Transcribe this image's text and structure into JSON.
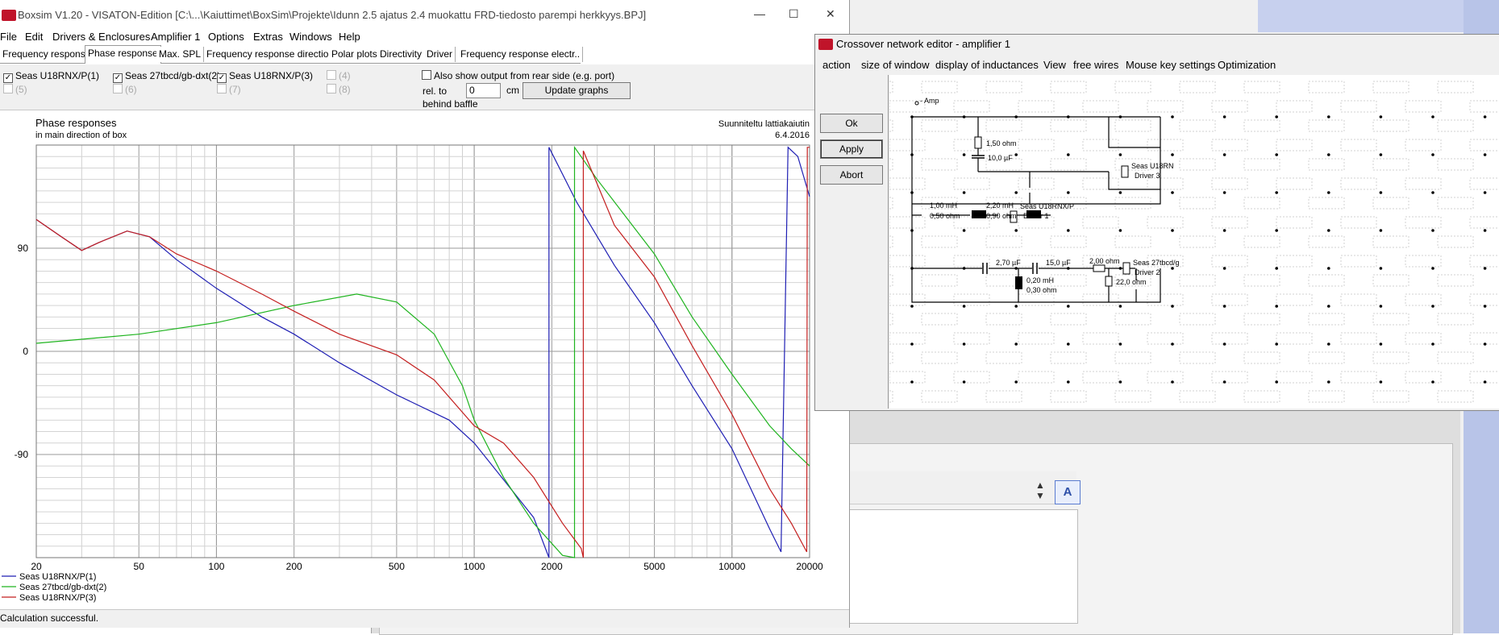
{
  "main_window": {
    "title": "Boxsim V1.20 - VISATON-Edition [C:\\...\\Kaiuttimet\\BoxSim\\Projekte\\Idunn 2.5 ajatus 2.4 muokattu FRD-tiedosto parempi herkkyys.BPJ]",
    "controls": {
      "minimize": "—",
      "maximize": "☐",
      "close": "✕"
    },
    "menu": [
      "File",
      "Edit",
      "Drivers & Enclosures",
      "Amplifier 1",
      "Options",
      "Extras",
      "Windows",
      "Help"
    ],
    "tabs": [
      "Frequency response.",
      "Phase response",
      "Max. SPL",
      "Frequency response directions",
      "Polar plots",
      "Directivity",
      "Driver",
      "Frequency response electr.."
    ],
    "active_tab": "Phase response",
    "drivers": [
      {
        "label": "Seas U18RNX/P(1)",
        "checked": true
      },
      {
        "label": "Seas 27tbcd/gb-dxt(2)",
        "checked": true
      },
      {
        "label": "Seas U18RNX/P(3)",
        "checked": true
      },
      {
        "label": "(4)",
        "checked": false
      },
      {
        "label": "(5)",
        "checked": false
      },
      {
        "label": "(6)",
        "checked": false
      },
      {
        "label": "(7)",
        "checked": false
      },
      {
        "label": "(8)",
        "checked": false
      }
    ],
    "rear_side_label": "Also show output from rear side (e.g. port)",
    "rel_to_label": "rel. to",
    "behind_baffle_label": "behind baffle",
    "rel_value": "0",
    "rel_unit": "cm",
    "update_button": "Update graphs",
    "status": "Calculation successful."
  },
  "chart_data": {
    "type": "line",
    "title": "Phase responses",
    "subtitle": "in main direction of box",
    "annotation_right_1": "Suunniteltu lattiakaiutin",
    "annotation_right_2": "6.4.2016",
    "x_scale": "log",
    "xlim": [
      20,
      20000
    ],
    "ylim": [
      -180,
      180
    ],
    "x_ticks": [
      20,
      50,
      100,
      200,
      500,
      1000,
      2000,
      5000,
      10000,
      20000
    ],
    "y_ticks": [
      90,
      0,
      -90
    ],
    "grid": true,
    "legend_position": "bottom-left",
    "series": [
      {
        "name": "Seas U18RNX/P(1)",
        "color": "#1f1fb4",
        "points": [
          [
            20,
            115
          ],
          [
            25,
            100
          ],
          [
            30,
            88
          ],
          [
            35,
            95
          ],
          [
            45,
            105
          ],
          [
            55,
            100
          ],
          [
            70,
            80
          ],
          [
            100,
            55
          ],
          [
            150,
            30
          ],
          [
            200,
            15
          ],
          [
            300,
            -10
          ],
          [
            500,
            -38
          ],
          [
            800,
            -60
          ],
          [
            1000,
            -80
          ],
          [
            1300,
            -112
          ],
          [
            1700,
            -145
          ],
          [
            1950,
            -180
          ],
          [
            1950,
            178
          ],
          [
            2500,
            130
          ],
          [
            3500,
            75
          ],
          [
            5000,
            25
          ],
          [
            7000,
            -30
          ],
          [
            10000,
            -85
          ],
          [
            14000,
            -155
          ],
          [
            15500,
            -175
          ],
          [
            16500,
            178
          ],
          [
            18000,
            170
          ],
          [
            20000,
            135
          ]
        ]
      },
      {
        "name": "Seas 27tbcd/gb-dxt(2)",
        "color": "#1fb41f",
        "points": [
          [
            20,
            7
          ],
          [
            50,
            15
          ],
          [
            100,
            25
          ],
          [
            200,
            40
          ],
          [
            350,
            50
          ],
          [
            500,
            43
          ],
          [
            700,
            15
          ],
          [
            900,
            -30
          ],
          [
            1000,
            -60
          ],
          [
            1300,
            -110
          ],
          [
            1700,
            -150
          ],
          [
            2200,
            -178
          ],
          [
            2450,
            -180
          ],
          [
            2450,
            178
          ],
          [
            3000,
            150
          ],
          [
            5000,
            85
          ],
          [
            7000,
            30
          ],
          [
            10000,
            -20
          ],
          [
            14000,
            -65
          ],
          [
            17000,
            -85
          ],
          [
            20000,
            -100
          ]
        ]
      },
      {
        "name": "Seas U18RNX/P(3)",
        "color": "#c41f1f",
        "points": [
          [
            20,
            115
          ],
          [
            25,
            100
          ],
          [
            30,
            88
          ],
          [
            35,
            95
          ],
          [
            45,
            105
          ],
          [
            55,
            100
          ],
          [
            70,
            85
          ],
          [
            100,
            70
          ],
          [
            150,
            50
          ],
          [
            200,
            35
          ],
          [
            300,
            15
          ],
          [
            500,
            -3
          ],
          [
            700,
            -25
          ],
          [
            1000,
            -65
          ],
          [
            1300,
            -80
          ],
          [
            1700,
            -110
          ],
          [
            2200,
            -150
          ],
          [
            2600,
            -172
          ],
          [
            2650,
            -180
          ],
          [
            2650,
            175
          ],
          [
            3500,
            110
          ],
          [
            5000,
            65
          ],
          [
            7000,
            5
          ],
          [
            10000,
            -55
          ],
          [
            14000,
            -120
          ],
          [
            17000,
            -150
          ],
          [
            19500,
            -175
          ],
          [
            19600,
            178
          ],
          [
            20000,
            178
          ]
        ]
      }
    ]
  },
  "crossover_window": {
    "title": "Crossover network editor - amplifier 1",
    "menu": [
      "action",
      "size of window",
      "display of inductances",
      "View",
      "free wires",
      "Mouse key settings",
      "Optimization"
    ],
    "buttons": {
      "ok": "Ok",
      "apply": "Apply",
      "abort": "Abort"
    },
    "labels": {
      "amp": "- Amp",
      "r1": "1,50 ohm",
      "c1": "10,0 µF",
      "driver3_name": "Seas U18RN",
      "driver3": "Driver 3",
      "l1": "1,00 mH",
      "l1r": "0,50 ohm",
      "l2": "2,20 mH",
      "l2r": "0,90 ohm",
      "driver1_name": "Seas U18RNX/P",
      "driver1": "Driver 1",
      "c2": "2,70 µF",
      "c3": "15,0 µF",
      "r2": "2,00 ohm",
      "driver2_name": "Seas 27tbcd/g",
      "driver2": "Driver 2",
      "l3": "0,20 mH",
      "l3r": "0,30 ohm",
      "r3": "22,0 ohm"
    }
  }
}
